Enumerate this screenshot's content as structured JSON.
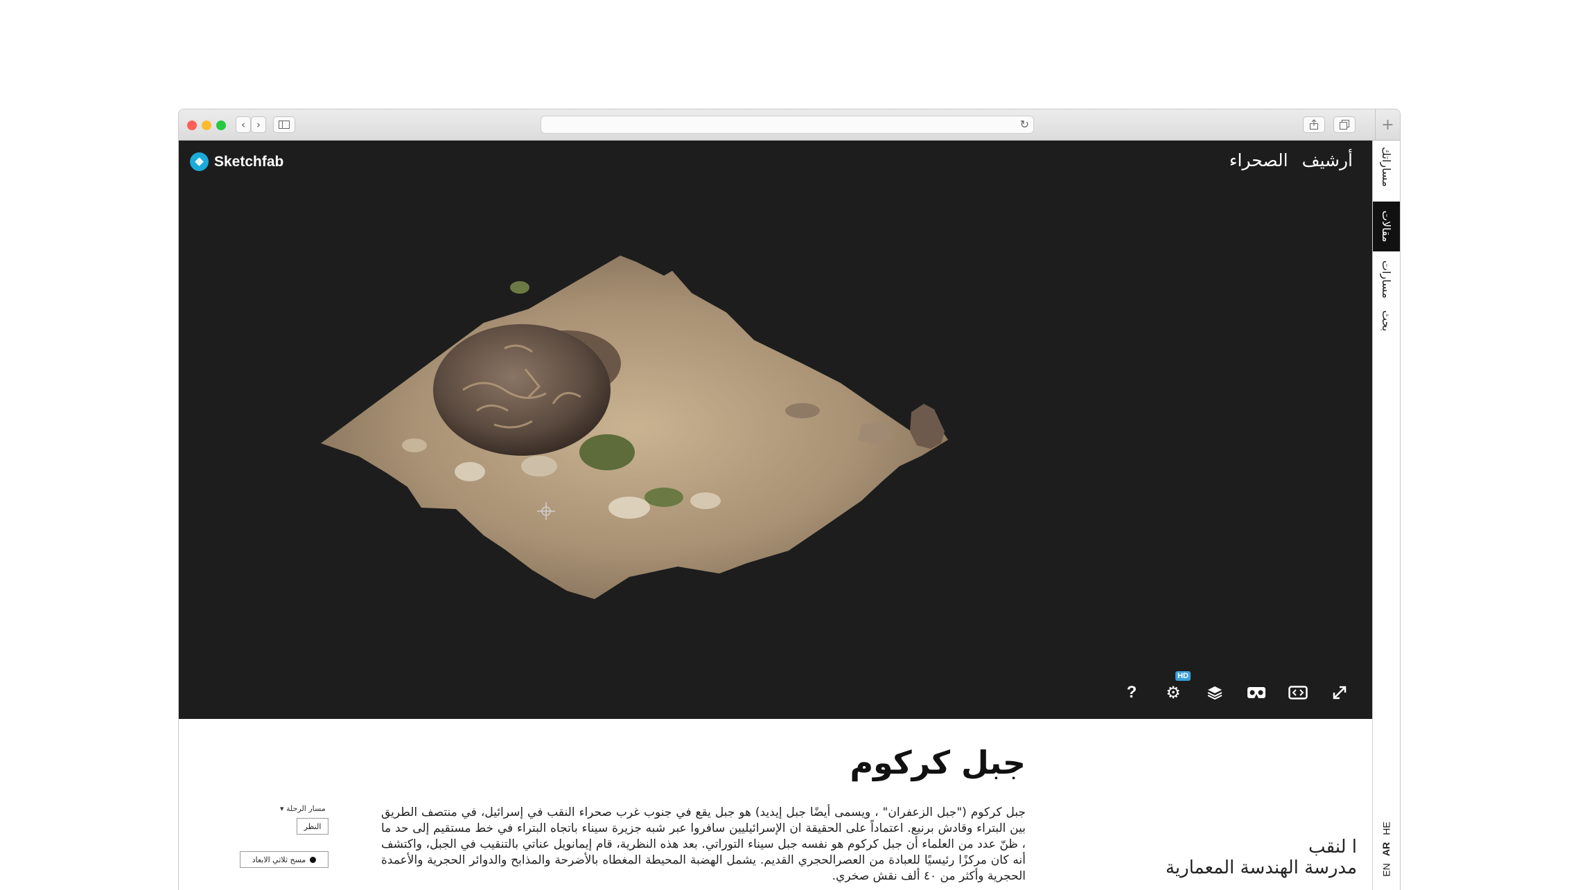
{
  "browser": {
    "url": "",
    "back_icon": "chevron-left-icon",
    "forward_icon": "chevron-right-icon",
    "plus_label": "+"
  },
  "viewer": {
    "brand": "Sketchfab",
    "brand_color": "#1caad9",
    "nav": [
      "أرشيف",
      "الصحراء"
    ],
    "hd_badge": "HD",
    "controls": [
      "help-icon",
      "settings-icon",
      "layers-icon",
      "vr-icon",
      "embed-icon",
      "fullscreen-icon"
    ],
    "help_label": "?"
  },
  "sidebar": {
    "items": [
      "مساراتك",
      "مقالات",
      "مسارات",
      "بحث"
    ],
    "active_index": 1,
    "langs": [
      "HE",
      "AR",
      "EN"
    ]
  },
  "article": {
    "title": "جبل كركوم",
    "body": "جبل كركوم (\"جبل الزعفران\" ، ويسمى أيضًا جبل إيديد) هو جبل يقع في جنوب غرب صحراء النقب في إسرائيل، في منتصف الطريق بين البتراء وقادش برنيع. اعتماداً على الحقيقة ان الإسرائيليين سافروا عبر شبه جزيرة سيناء باتجاه البتراء في خط مستقيم إلى حد ما ، ظنّ عدد من العلماء أن جبل كركوم هو نفسه جبل سيناء التوراتي. بعد هذه النظرية، قام إيمانويل عناتي بالتنقيب في الجبل، واكتشف أنه كان مركزًا رئيسيًا للعبادة من العصرالحجري القديم. يشمل الهضبة المحيطة المغطاه بالأضرحة والمذابح والدوائر الحجرية والأعمدة الحجرية وأكثر من ٤٠ ألف نقش صخري."
  },
  "route": {
    "label": "مسار الرحلة",
    "view_button": "النظر",
    "scan_button": "مسح ثلاثي الابعاد"
  },
  "school": {
    "line1": "ا لنقب",
    "line2": "مدرسة الهندسة المعمارية"
  }
}
